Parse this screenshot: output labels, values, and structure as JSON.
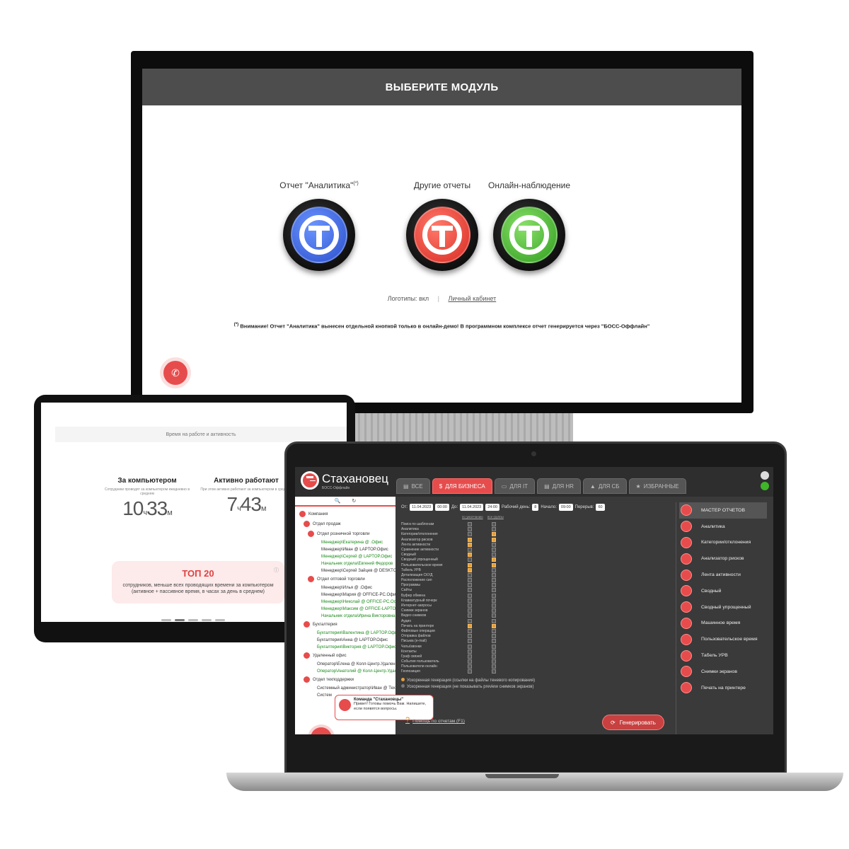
{
  "monitor": {
    "header_title": "ВЫБЕРИТЕ МОДУЛЬ",
    "modules": [
      {
        "label": "Отчет \"Аналитика\"",
        "mark": "(*)",
        "color": "#3a6ae0",
        "icon": "stakhanovets-blue-icon"
      },
      {
        "label": "Другие отчеты",
        "mark": "",
        "color": "#e53a32",
        "icon": "stakhanovets-red-icon"
      },
      {
        "label": "Онлайн-наблюдение",
        "mark": "",
        "color": "#3fb52a",
        "icon": "stakhanovets-green-icon"
      }
    ],
    "logos_text": "Логотипы: вкл",
    "separator": "|",
    "cabinet_link": "Личный кабинет",
    "warning_mark": "(*)",
    "warning_text": "Внимание! Отчет \"Аналитика\" вынесен отдельной кнопкой только в онлайн-демо! В программном комплексе отчет генерируется через \"БОСС-Оффлайн\"",
    "call_icon": "phone-icon"
  },
  "tablet": {
    "caption": "Время на работе и активность",
    "stats": [
      {
        "title": "За компьютером",
        "sub": "Сотрудники проводят за компьютером ежедневно в среднем",
        "hours": "10",
        "h_unit": "ч",
        "minutes": "33",
        "m_unit": "м"
      },
      {
        "title": "Активно работают",
        "sub": "При этом активно работают за компьютером в среднем",
        "hours": "7",
        "h_unit": "ч",
        "minutes": "43",
        "m_unit": "м"
      }
    ],
    "top20_title": "ТОП 20",
    "top20_text": "сотрудников, меньше всех проводящих времени за компьютером (активное + пассивное время, в часах за день в среднем)",
    "info_icon": "ⓘ"
  },
  "app": {
    "name": "Стахановец",
    "subtitle": "БОСС-Оффлайн",
    "tabs": [
      {
        "label": "ВСЕ",
        "icon": "▤"
      },
      {
        "label": "ДЛЯ БИЗНЕСА",
        "icon": "$"
      },
      {
        "label": "ДЛЯ IT",
        "icon": "▭"
      },
      {
        "label": "ДЛЯ HR",
        "icon": "▤"
      },
      {
        "label": "ДЛЯ СБ",
        "icon": "▲"
      },
      {
        "label": "ИЗБРАННЫЕ",
        "icon": "★"
      }
    ],
    "active_tab": 1,
    "tree_tools": {
      "search": "🔍",
      "refresh": "↻"
    },
    "tree": [
      {
        "label": "Компания",
        "indent": 0,
        "dot": true,
        "green": false
      },
      {
        "label": "Отдел продаж",
        "indent": 1,
        "dot": true,
        "green": false
      },
      {
        "label": "Отдел розничной торговли",
        "indent": 2,
        "dot": true,
        "green": false
      },
      {
        "label": "Менеджер\\Екатерина @ .Офис",
        "indent": 3,
        "dot": false,
        "green": true
      },
      {
        "label": "Менеджер\\Иван @ LAPTOP.Офис",
        "indent": 3,
        "dot": false,
        "green": false
      },
      {
        "label": "Менеджер\\Сергей @ LAPTOP.Офис",
        "indent": 3,
        "dot": false,
        "green": true
      },
      {
        "label": "Начальник отдела\\Евгений Федоров",
        "indent": 3,
        "dot": false,
        "green": true
      },
      {
        "label": "Менеджер\\Сергей Зайцев @ DESKTC",
        "indent": 3,
        "dot": false,
        "green": false
      },
      {
        "label": "Отдел оптовой торговли",
        "indent": 2,
        "dot": true,
        "green": false
      },
      {
        "label": "Менеджер\\Илья @ .Офис",
        "indent": 3,
        "dot": false,
        "green": false
      },
      {
        "label": "Менеджер\\Мария @ OFFICE-PC.Офис",
        "indent": 3,
        "dot": false,
        "green": false
      },
      {
        "label": "Менеджер\\Николай @ OFFICE-PC.Ос",
        "indent": 3,
        "dot": false,
        "green": true
      },
      {
        "label": "Менеджер\\Максим @ OFFICE-LAPTO",
        "indent": 3,
        "dot": false,
        "green": true
      },
      {
        "label": "Начальник отдела\\Ирина Викторовна",
        "indent": 3,
        "dot": false,
        "green": true
      },
      {
        "label": "Бухгалтерия",
        "indent": 1,
        "dot": true,
        "green": false
      },
      {
        "label": "Бухгалтерия\\Валентина @ LAPTOP.Офи",
        "indent": 2,
        "dot": false,
        "green": true
      },
      {
        "label": "Бухгалтерия\\Анна @ LAPTOP.Офис",
        "indent": 2,
        "dot": false,
        "green": false
      },
      {
        "label": "Бухгалтерия\\Виктория @ LAPTOP.Офис",
        "indent": 2,
        "dot": false,
        "green": true
      },
      {
        "label": "Удаленный офис",
        "indent": 1,
        "dot": true,
        "green": false
      },
      {
        "label": "Оператор\\Елена @ Колл-Центр.Удален",
        "indent": 2,
        "dot": false,
        "green": false
      },
      {
        "label": "Оператор\\Анатолий @ Колл-Центр.Удал",
        "indent": 2,
        "dot": false,
        "green": true
      },
      {
        "label": "Отдел техподдержки",
        "indent": 1,
        "dot": true,
        "green": false
      },
      {
        "label": "Системный администратор\\Иван @ Тех",
        "indent": 2,
        "dot": false,
        "green": false
      },
      {
        "label": "Систем",
        "indent": 2,
        "dot": false,
        "green": false
      }
    ],
    "date": {
      "from_label": "От:",
      "from_date": "11.04.2023",
      "from_time": "00:00",
      "to_label": "До:",
      "to_date": "11.04.2023",
      "to_time": "24:00",
      "day_label": "Рабочий день:",
      "day_value": "8",
      "start_label": "Начало:",
      "start_value": "09:00",
      "break_label": "Перерыв:",
      "break_value": "60"
    },
    "col_head_1": "по умолчанию",
    "col_head_2": "все группы",
    "reports_list": [
      {
        "label": "Поиск по шаблонам",
        "c1": false,
        "c2": false
      },
      {
        "label": "Аналитика",
        "c1": false,
        "c2": false
      },
      {
        "label": "Категории/отклонения",
        "c1": false,
        "c2": true
      },
      {
        "label": "Анализатор рисков",
        "c1": true,
        "c2": true
      },
      {
        "label": "Лента активности",
        "c1": true,
        "c2": false
      },
      {
        "label": "Сравнение активности",
        "c1": false,
        "c2": false
      },
      {
        "label": "Сводный",
        "c1": true,
        "c2": false
      },
      {
        "label": "Сводный упрощенный",
        "c1": false,
        "c2": true
      },
      {
        "label": "Пользовательское время",
        "c1": true,
        "c2": true
      },
      {
        "label": "Табель УРВ",
        "c1": true,
        "c2": false
      },
      {
        "label": "Детализация СКУД",
        "c1": false,
        "c2": false
      },
      {
        "label": "Расположение сил",
        "c1": false,
        "c2": false
      },
      {
        "label": "Программы",
        "c1": false,
        "c2": false
      },
      {
        "label": "Сайты",
        "c1": false,
        "c2": false
      },
      {
        "label": "Буфер обмена",
        "c1": false,
        "c2": false
      },
      {
        "label": "Клавиатурный почерк",
        "c1": false,
        "c2": false
      },
      {
        "label": "Интернет-запросы",
        "c1": false,
        "c2": false
      },
      {
        "label": "Снимки экранов",
        "c1": false,
        "c2": false
      },
      {
        "label": "Видео снимков",
        "c1": false,
        "c2": false
      },
      {
        "label": "Аудио",
        "c1": false,
        "c2": false
      },
      {
        "label": "Печать на принтере",
        "c1": true,
        "c2": true
      },
      {
        "label": "Файловые операции",
        "c1": false,
        "c2": false
      },
      {
        "label": "Отправка файлов",
        "c1": false,
        "c2": false
      },
      {
        "label": "Письма (e-mail)",
        "c1": false,
        "c2": false
      },
      {
        "label": "Чаты/звонки",
        "c1": false,
        "c2": false
      },
      {
        "label": "Контакты",
        "c1": false,
        "c2": false
      },
      {
        "label": "Граф связей",
        "c1": false,
        "c2": false
      },
      {
        "label": "События пользователь",
        "c1": false,
        "c2": false
      },
      {
        "label": "Пользователи онлайн",
        "c1": false,
        "c2": false
      },
      {
        "label": "Геопозиция",
        "c1": false,
        "c2": false
      }
    ],
    "opt_fast_1": "Ускоренная генерация (ссылки на файлы теневого копирования)",
    "opt_fast_2": "Ускоренная генерация (не показывать preview снимков экранов)",
    "help": "Помощь по отчетам (F1)",
    "generate": "Генерировать",
    "chat_title": "Команда \"Стахановцы\"",
    "chat_text": "Привет! Готовы помочь Вам. Напишите, если появятся вопросы.",
    "menu": [
      {
        "label": "МАСТЕР ОТЧЕТОВ",
        "icon": "briefcase-icon"
      },
      {
        "label": "Аналитика",
        "icon": "bar-chart-icon"
      },
      {
        "label": "Категории/отклонения",
        "icon": "sigma-icon"
      },
      {
        "label": "Анализатор рисков",
        "icon": "risk-icon"
      },
      {
        "label": "Лента активности",
        "icon": "feed-icon"
      },
      {
        "label": "Сводный",
        "icon": "pie-icon"
      },
      {
        "label": "Сводный упрощенный",
        "icon": "pie-simple-icon"
      },
      {
        "label": "Машинное время",
        "icon": "clock-icon"
      },
      {
        "label": "Пользовательское время",
        "icon": "users-icon"
      },
      {
        "label": "Табель УРВ",
        "icon": "timesheet-icon"
      },
      {
        "label": "Снимки экранов",
        "icon": "screenshot-icon"
      },
      {
        "label": "Печать на принтере",
        "icon": "printer-icon"
      }
    ],
    "active_menu": 0
  }
}
